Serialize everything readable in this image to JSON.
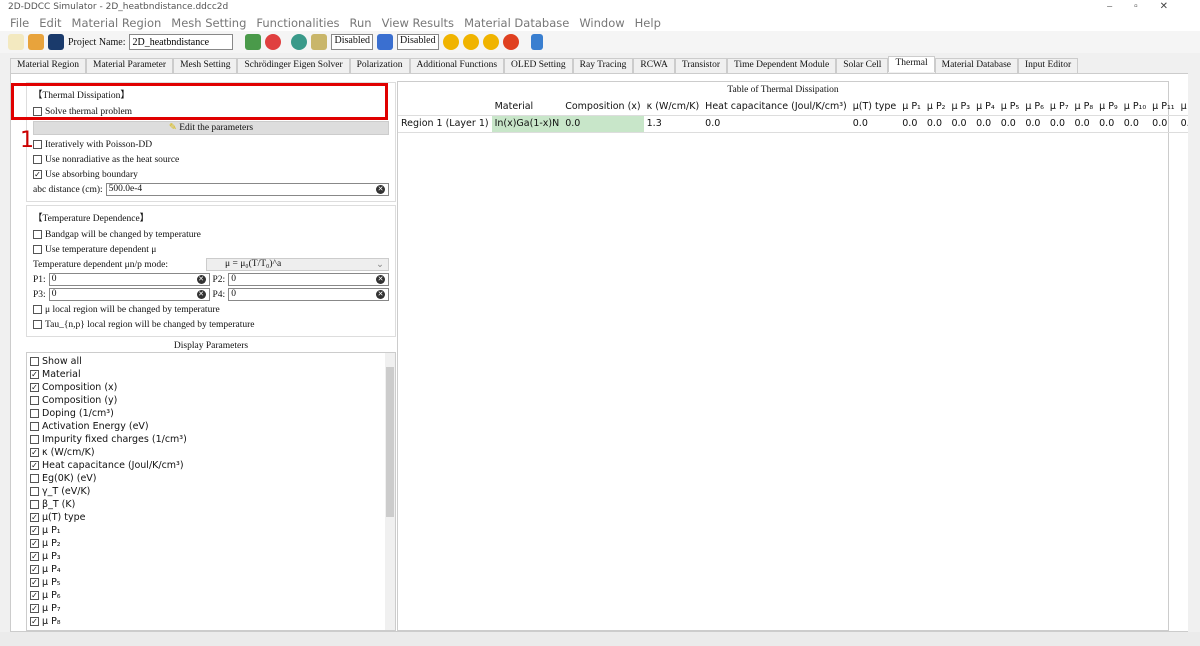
{
  "window": {
    "title": "2D-DDCC Simulator - 2D_heatbndistance.ddcc2d"
  },
  "menu": [
    "File",
    "Edit",
    "Material Region",
    "Mesh Setting",
    "Functionalities",
    "Run",
    "View Results",
    "Material Database",
    "Window",
    "Help"
  ],
  "toolbar": {
    "project_label": "Project Name:",
    "project_name": "2D_heatbndistance",
    "disabled1": "Disabled",
    "disabled2": "Disabled"
  },
  "tabs": [
    "Material Region",
    "Material Parameter",
    "Mesh Setting",
    "Schrödinger Eigen Solver",
    "Polarization",
    "Additional Functions",
    "OLED Setting",
    "Ray Tracing",
    "RCWA",
    "Transistor",
    "Time Dependent Module",
    "Solar Cell",
    "Thermal",
    "Material Database",
    "Input Editor"
  ],
  "active_tab": "Thermal",
  "thermal": {
    "header": "【Thermal Dissipation】",
    "solve": "Solve thermal problem",
    "edit_button": "Edit the parameters",
    "iterative": "Iteratively with Poisson-DD",
    "nonradiative": "Use nonradiative as the heat source",
    "absorbing": "Use absorbing boundary",
    "abc_label": "abc distance (cm):",
    "abc_value": "500.0e-4",
    "annotation": "1"
  },
  "temp": {
    "header": "【Temperature Dependence】",
    "bandgap": "Bandgap will be changed by temperature",
    "use_mu": "Use temperature dependent μ",
    "mode_label": "Temperature dependent μn/p mode:",
    "mode_value": "μ = μ₀(T/T₀)^a",
    "p1_label": "P1:",
    "p1": "0",
    "p2_label": "P2:",
    "p2": "0",
    "p3_label": "P3:",
    "p3": "0",
    "p4_label": "P4:",
    "p4": "0",
    "mu_local": "μ local region will be changed by temperature",
    "tau_local": "Tau_{n,p} local region will be changed by temperature"
  },
  "display": {
    "title": "Display Parameters",
    "items": [
      {
        "label": "Show all",
        "checked": false
      },
      {
        "label": "Material",
        "checked": true
      },
      {
        "label": "Composition (x)",
        "checked": true
      },
      {
        "label": "Composition (y)",
        "checked": false
      },
      {
        "label": "Doping (1/cm³)",
        "checked": false
      },
      {
        "label": "Activation Energy (eV)",
        "checked": false
      },
      {
        "label": "Impurity fixed charges (1/cm³)",
        "checked": false
      },
      {
        "label": "κ (W/cm/K)",
        "checked": true
      },
      {
        "label": "Heat capacitance (Joul/K/cm³)",
        "checked": true
      },
      {
        "label": "Eg(0K) (eV)",
        "checked": false
      },
      {
        "label": "γ_T (eV/K)",
        "checked": false
      },
      {
        "label": "β_T (K)",
        "checked": false
      },
      {
        "label": "μ(T) type",
        "checked": true
      },
      {
        "label": "μ P₁",
        "checked": true
      },
      {
        "label": "μ P₂",
        "checked": true
      },
      {
        "label": "μ P₃",
        "checked": true
      },
      {
        "label": "μ P₄",
        "checked": true
      },
      {
        "label": "μ P₅",
        "checked": true
      },
      {
        "label": "μ P₆",
        "checked": true
      },
      {
        "label": "μ P₇",
        "checked": true
      },
      {
        "label": "μ P₈",
        "checked": true
      }
    ]
  },
  "table": {
    "title": "Table of Thermal Dissipation",
    "headers": [
      "",
      "Material",
      "Composition (x)",
      "κ (W/cm/K)",
      "Heat capacitance (Joul/K/cm³)",
      "μ(T) type",
      "μ P₁",
      "μ P₂",
      "μ P₃",
      "μ P₄",
      "μ P₅",
      "μ P₆",
      "μ P₇",
      "μ P₈",
      "μ P₉",
      "μ P₁₀",
      "μ P₁₁",
      "μ P₁₂",
      "τ (T)"
    ],
    "rows": [
      [
        "Region 1 (Layer 1)",
        "In(x)Ga(1-x)N",
        "0.0",
        "1.3",
        "0.0",
        "0.0",
        "0.0",
        "0.0",
        "0.0",
        "0.0",
        "0.0",
        "0.0",
        "0.0",
        "0.0",
        "0.0",
        "0.0",
        "0.0",
        "0.0",
        "0.0"
      ]
    ]
  }
}
